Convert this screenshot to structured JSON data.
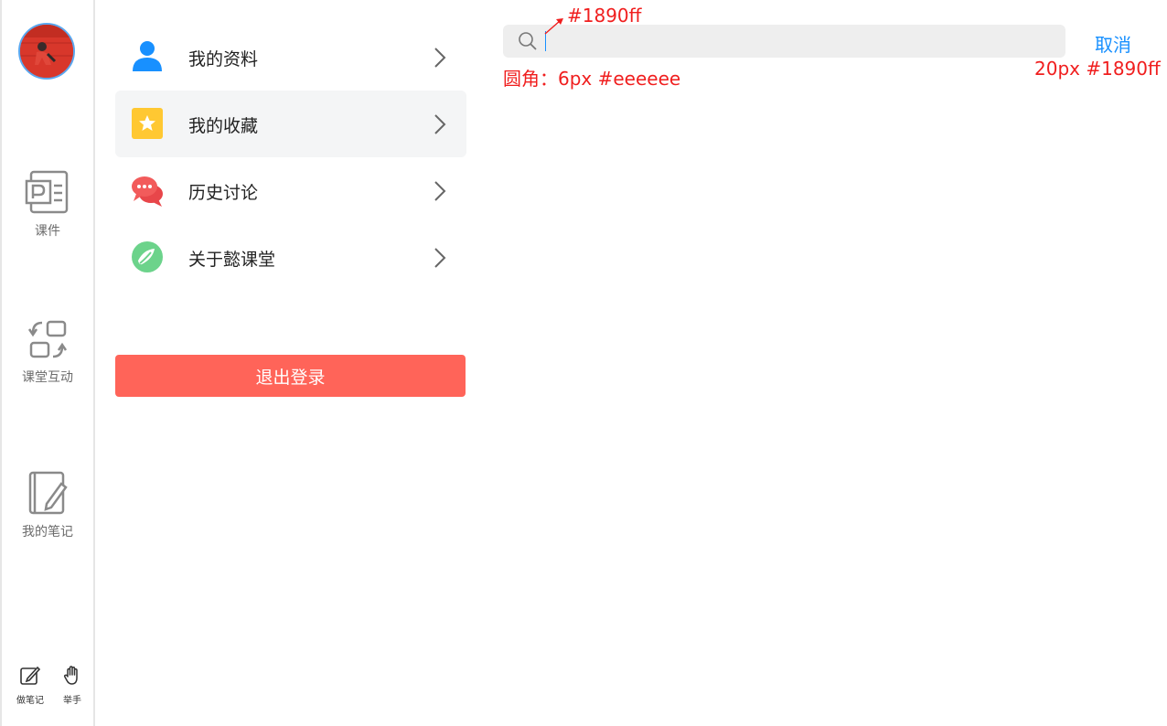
{
  "rail": {
    "avatar": "user-avatar-photo",
    "items": [
      {
        "label": "课件",
        "icon": "courseware-icon"
      },
      {
        "label": "课堂互动",
        "icon": "interaction-icon"
      },
      {
        "label": "我的笔记",
        "icon": "notes-icon"
      }
    ],
    "bottom": [
      {
        "label": "做笔记",
        "icon": "edit-icon"
      },
      {
        "label": "举手",
        "icon": "hand-icon"
      }
    ]
  },
  "menu": {
    "items": [
      {
        "label": "我的资料",
        "icon": "user-icon",
        "color": "#1890ff"
      },
      {
        "label": "我的收藏",
        "icon": "star-icon",
        "color": "#ffc832",
        "active": true
      },
      {
        "label": "历史讨论",
        "icon": "chat-icon",
        "color": "#f25b5b"
      },
      {
        "label": "关于懿课堂",
        "icon": "about-icon",
        "color": "#6cd38b"
      }
    ],
    "logout_label": "退出登录",
    "logout_color": "#ff6459"
  },
  "search": {
    "value": "",
    "background": "#eeeeee",
    "caret_color": "#1890ff"
  },
  "cancel_label": "取消",
  "annotations": {
    "caret_color_note": "#1890ff",
    "search_note": "圆角：6px  #eeeeee",
    "cancel_note": "20px  #1890ff"
  }
}
